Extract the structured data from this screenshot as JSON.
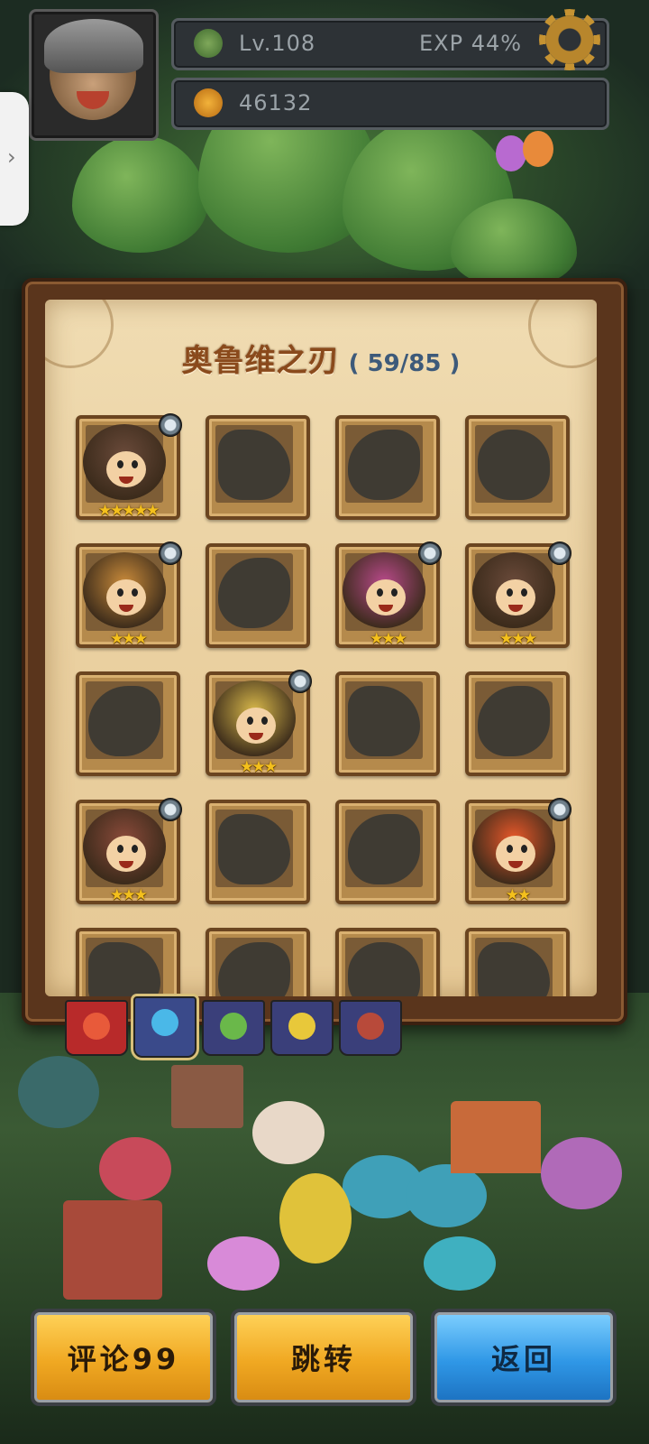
{
  "player": {
    "level": "Lv.108",
    "exp": "EXP 44%",
    "currency": "46132"
  },
  "collection": {
    "title": "奥鲁维之刃",
    "count": "( 59/85 )"
  },
  "cards": [
    {
      "unlocked": true,
      "stars": "★★★★★",
      "badge": true
    },
    {
      "unlocked": false
    },
    {
      "unlocked": false
    },
    {
      "unlocked": false
    },
    {
      "unlocked": true,
      "stars": "★★★",
      "badge": true
    },
    {
      "unlocked": false
    },
    {
      "unlocked": true,
      "stars": "★★★",
      "badge": true
    },
    {
      "unlocked": true,
      "stars": "★★★",
      "badge": true
    },
    {
      "unlocked": false
    },
    {
      "unlocked": true,
      "stars": "★★★",
      "badge": true
    },
    {
      "unlocked": false
    },
    {
      "unlocked": false
    },
    {
      "unlocked": true,
      "stars": "★★★",
      "badge": true
    },
    {
      "unlocked": false
    },
    {
      "unlocked": false
    },
    {
      "unlocked": true,
      "stars": "★★",
      "badge": true
    },
    {
      "unlocked": false
    },
    {
      "unlocked": false
    },
    {
      "unlocked": false
    },
    {
      "unlocked": false
    }
  ],
  "buttons": {
    "comment": "评论99",
    "jump": "跳转",
    "back": "返回"
  },
  "colors": {
    "panel_frame": "#5a351c",
    "parchment": "#f0dcb2",
    "title": "#8a4a1c",
    "star": "#f4c01c",
    "gold_button": "#f0a822",
    "blue_button": "#2f97e6"
  }
}
